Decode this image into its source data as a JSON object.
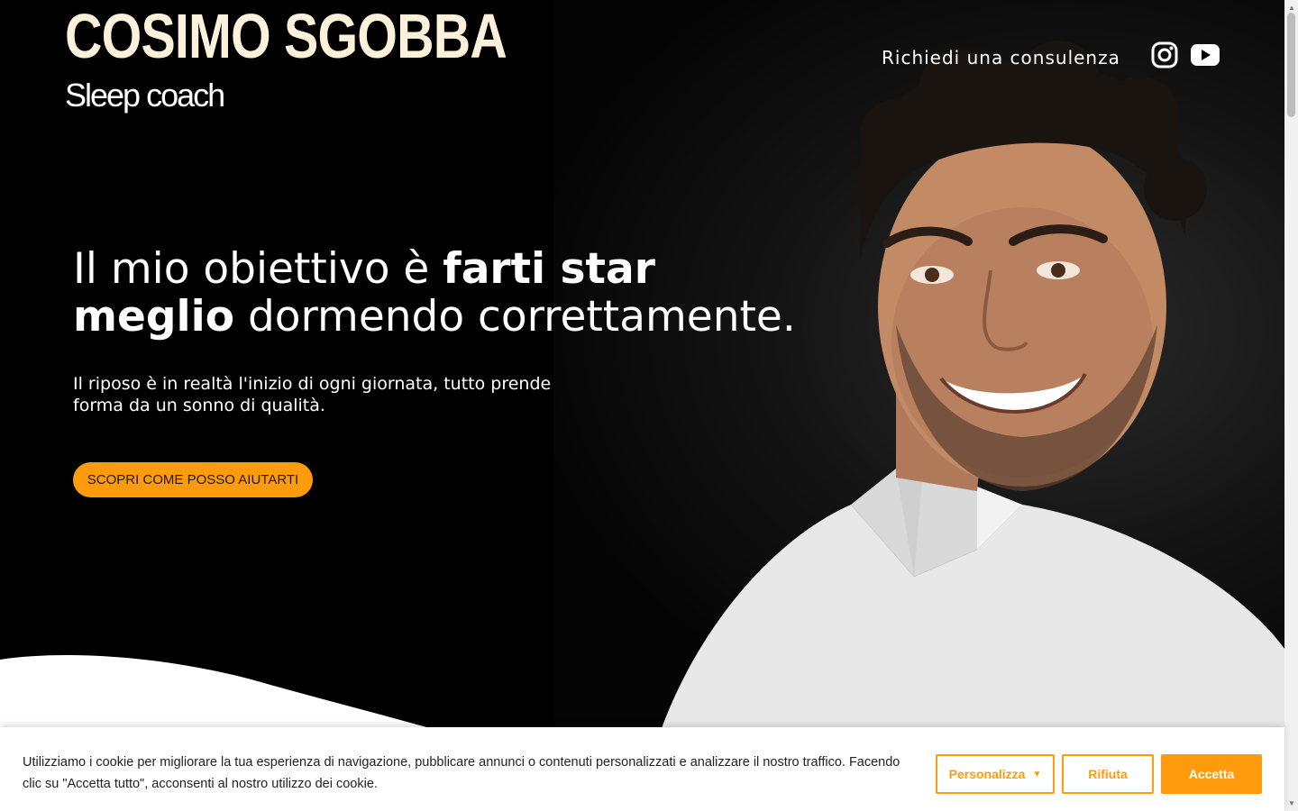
{
  "brand": {
    "name": "COSIMO SGOBBA",
    "tagline": "Sleep coach",
    "name_color": "#fdf1dc"
  },
  "nav": {
    "consult_link": "Richiedi una consulenza",
    "icons": [
      "instagram-icon",
      "youtube-icon"
    ]
  },
  "hero": {
    "headline_part1": "Il mio obiettivo è ",
    "headline_bold1": "farti star",
    "headline_bold2": "meglio",
    "headline_part2": " dormendo correttamente.",
    "subtext": "Il riposo è in realtà l'inizio di ogni giornata, tutto prende forma da un sonno di qualità.",
    "cta_label": "SCOPRI COME POSSO AIUTARTI"
  },
  "cookie_banner": {
    "text": "Utilizziamo i cookie per migliorare la tua esperienza di navigazione, pubblicare annunci o contenuti personalizzati e analizzare il nostro traffico. Facendo clic su \"Accetta tutto\", acconsenti al nostro utilizzo dei cookie.",
    "customize_label": "Personalizza",
    "reject_label": "Rifiuta",
    "accept_label": "Accetta"
  },
  "colors": {
    "accent": "#ff9b0d",
    "background": "#000000",
    "text": "#ffffff"
  }
}
